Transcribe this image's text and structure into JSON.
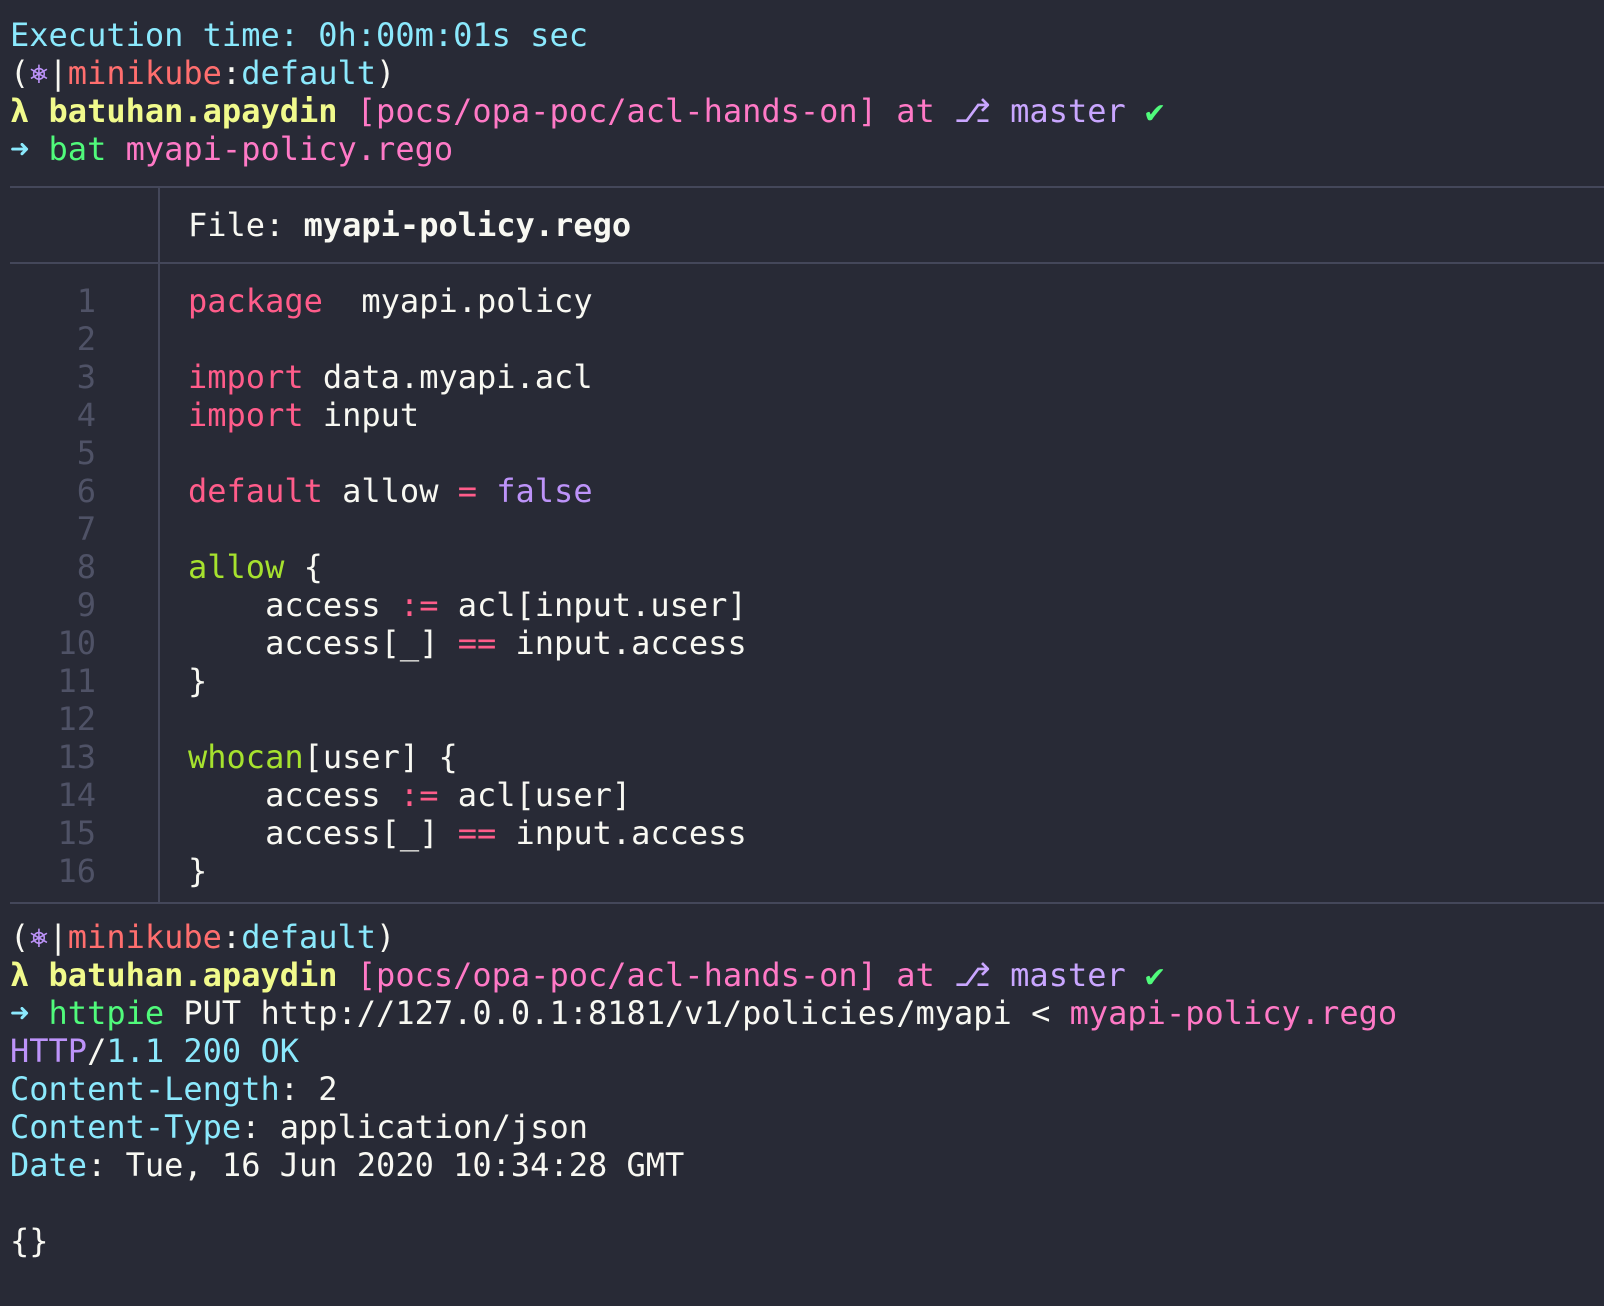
{
  "execution_time": "Execution time: 0h:00m:01s sec",
  "prompt1": {
    "open_paren": "(",
    "k8s_icon": "⎈",
    "pipe": "|",
    "context": "minikube",
    "colon": ":",
    "namespace": "default",
    "close_paren": ")",
    "lambda": "λ",
    "user": "batuhan.apaydin",
    "path": "[pocs/opa-poc/acl-hands-on]",
    "at": "at",
    "branch_icon": "",
    "branch": "master",
    "check": "✔",
    "arrow": "➜",
    "command": "bat",
    "arg": "myapi-policy.rego"
  },
  "bat": {
    "file_label": "File: ",
    "file_name": "myapi-policy.rego",
    "line_numbers": [
      "1",
      "2",
      "3",
      "4",
      "5",
      "6",
      "7",
      "8",
      "9",
      "10",
      "11",
      "12",
      "13",
      "14",
      "15",
      "16"
    ],
    "code": {
      "l1_kw": "package",
      "l1_rest": "  myapi.policy",
      "l3_kw": "import",
      "l3_rest": " data.myapi.acl",
      "l4_kw": "import",
      "l4_rest": " input",
      "l6_kw": "default",
      "l6_mid": " allow ",
      "l6_op": "=",
      "l6_sp": " ",
      "l6_bool": "false",
      "l8_fn": "allow",
      "l8_rest": " {",
      "l9_a": "    access ",
      "l9_op": ":=",
      "l9_b": " acl[input.user]",
      "l10_a": "    access[_] ",
      "l10_op": "==",
      "l10_b": " input.access",
      "l11": "}",
      "l13_fn": "whocan",
      "l13_rest": "[user] {",
      "l14_a": "    access ",
      "l14_op": ":=",
      "l14_b": " acl[user]",
      "l15_a": "    access[_] ",
      "l15_op": "==",
      "l15_b": " input.access",
      "l16": "}"
    }
  },
  "prompt2": {
    "open_paren": "(",
    "k8s_icon": "⎈",
    "pipe": "|",
    "context": "minikube",
    "colon": ":",
    "namespace": "default",
    "close_paren": ")",
    "lambda": "λ",
    "user": "batuhan.apaydin",
    "path": "[pocs/opa-poc/acl-hands-on]",
    "at": "at",
    "branch_icon": "",
    "branch": "master",
    "check": "✔",
    "arrow": "➜",
    "command": "httpie",
    "args": " PUT http://127.0.0.1:8181/v1/policies/myapi < ",
    "redirect_file": "myapi-policy.rego"
  },
  "response": {
    "status_proto": "HTTP",
    "status_slash": "/",
    "status_ver": "1.1",
    "status_code": "200",
    "status_text": "OK",
    "content_length_key": "Content-Length",
    "content_length_val": "2",
    "content_type_key": "Content-Type",
    "content_type_val": "application/json",
    "date_key": "Date",
    "date_val": "Tue, 16 Jun 2020 10:34:28 GMT",
    "body": "{}"
  },
  "colors": {
    "background": "#282a36",
    "cyan": "#8be9fd",
    "pink": "#ff79c6",
    "keyword": "#ff5c8a",
    "function": "#a6e22e",
    "yellow": "#f1fa8c",
    "purple": "#bd93f9",
    "green": "#50fa7b"
  }
}
